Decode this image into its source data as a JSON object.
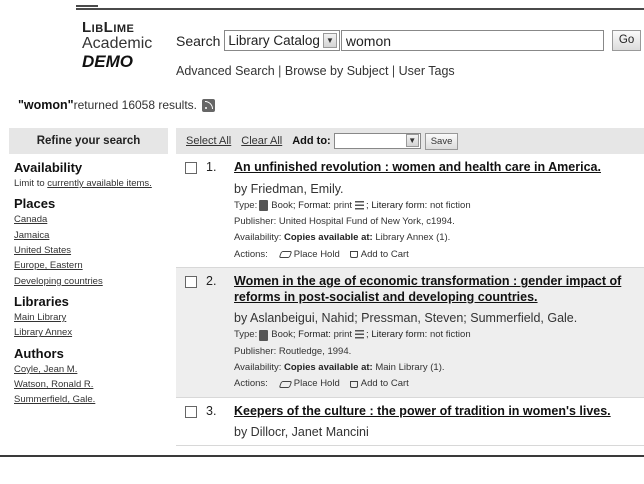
{
  "logo": {
    "line1": "LibLime",
    "line2": "Academic",
    "line3": "DEMO"
  },
  "search": {
    "label": "Search",
    "scope_value": "Library Catalog",
    "query_value": "womon",
    "go_label": "Go"
  },
  "nav_links": {
    "advanced": "Advanced Search",
    "sep1": " | ",
    "browse": "Browse by Subject",
    "sep2": " | ",
    "tags": "User Tags"
  },
  "results_summary": {
    "query": "\"womon\"",
    "text": " returned 16058 results."
  },
  "sidebar": {
    "header": "Refine your search",
    "availability_heading": "Availability",
    "availability_prefix": "Limit to ",
    "availability_link": "currently available items.",
    "places_heading": "Places",
    "places": [
      "Canada",
      "Jamaica",
      "United States",
      "Europe, Eastern",
      "Developing countries"
    ],
    "libraries_heading": "Libraries",
    "libraries": [
      "Main Library",
      "Library Annex"
    ],
    "authors_heading": "Authors",
    "authors": [
      "Coyle, Jean M.",
      "Watson, Ronald R.",
      "Summerfield, Gale."
    ]
  },
  "toolbar": {
    "select_all": "Select All",
    "clear_all": "Clear All",
    "add_to": "Add to:",
    "add_to_value": "",
    "save": "Save"
  },
  "labels": {
    "type": "Type: ",
    "book": "Book",
    "format": "; Format: ",
    "format_value": "print",
    "literary": "; Literary form: ",
    "literary_value": "not fiction",
    "publisher": "Publisher: ",
    "availability": "Availability: ",
    "copies": "Copies available at: ",
    "actions": "Actions: ",
    "place_hold": "Place Hold",
    "add_to_cart": "Add to Cart"
  },
  "results": [
    {
      "num": "1.",
      "title": "An unfinished revolution : women and health care in America.",
      "author": "by Friedman, Emily.",
      "publisher": "United Hospital Fund of New York, c1994.",
      "availability": "Library Annex (1)."
    },
    {
      "num": "2.",
      "title": "Women in the age of economic transformation : gender impact of reforms in post-socialist and developing countries.",
      "author": "by Aslanbeigui, Nahid; Pressman, Steven; Summerfield, Gale.",
      "publisher": "Routledge, 1994.",
      "availability": "Main Library (1)."
    },
    {
      "num": "3.",
      "title": "Keepers of the culture : the power of tradition in women's lives.",
      "author": "by Dillocr, Janet Mancini"
    }
  ]
}
